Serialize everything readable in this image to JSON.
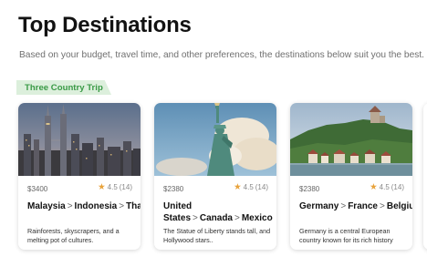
{
  "header": {
    "title": "Top Destinations",
    "subtitle": "Based on your budget, travel time, and other preferences, the destinations below suit you the best."
  },
  "trip_tag": "Three Country Trip",
  "cards": [
    {
      "price": "$3400",
      "rating": "4.5",
      "reviews": "(14)",
      "countries": [
        "Malaysia",
        "Indonesia",
        "Thailand"
      ],
      "separator": ">",
      "description": "Rainforests, skyscrapers, and a melting pot of cultures."
    },
    {
      "price": "$2380",
      "rating": "4.5",
      "reviews": "(14)",
      "countries": [
        "United States",
        "Canada",
        "Mexico"
      ],
      "separator": ">",
      "description": "The Statue of Liberty stands tall, and Hollywood stars.."
    },
    {
      "price": "$2380",
      "rating": "4.5",
      "reviews": "(14)",
      "countries": [
        "Germany",
        "France",
        "Belgium"
      ],
      "separator": ">",
      "description": "Germany is a central European country known for its rich history"
    }
  ],
  "icons": {
    "rating": "star-icon",
    "separator": "chevron-right-icon"
  },
  "colors": {
    "tag_bg": "#dcefdc",
    "tag_text": "#3a9a46",
    "star": "#e8a23a"
  }
}
